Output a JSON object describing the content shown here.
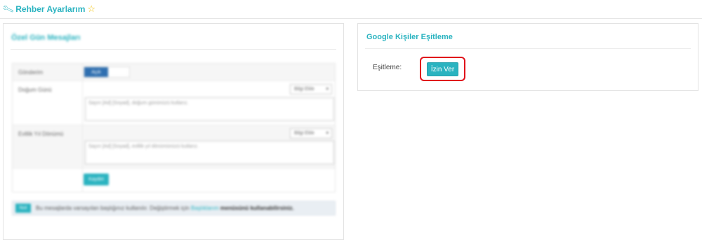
{
  "header": {
    "icon": "wrench-icon",
    "title": "Rehber Ayarlarım",
    "star_icon": "star-outline-icon"
  },
  "sms_panel": {
    "title": "Özel Gün Mesajları",
    "rows": [
      {
        "label": "Gönderim",
        "toggle_label": "Açık"
      },
      {
        "label": "Doğum Günü",
        "select_value": "Bilgi Ekle",
        "textarea_value": "Sayın [Ad] [Soyad], doğum gününüzü kutlarız."
      },
      {
        "label": "Evlilik Yıl Dönümü",
        "select_value": "Bilgi Ekle",
        "textarea_value": "Sayın [Ad] [Soyad], evlilik yıl dönümünüzü kutlarız."
      }
    ],
    "save_label": "Kaydet",
    "info": {
      "tag": "Not",
      "text_start": "Bu mesajlarda varsayılan başlığınız kullanılır. Değiştirmek için",
      "link": "Başlıklarım",
      "text_end": "menüsünü kullanabilirsiniz."
    }
  },
  "google_panel": {
    "title": "Google Kişiler Eşitleme",
    "sync_label": "Eşitleme:",
    "allow_button": "İzin Ver",
    "highlight_color": "#e0101a"
  },
  "colors": {
    "accent": "#2ab3c0",
    "toggle_on": "#2f6fb0",
    "star": "#f0c000"
  }
}
